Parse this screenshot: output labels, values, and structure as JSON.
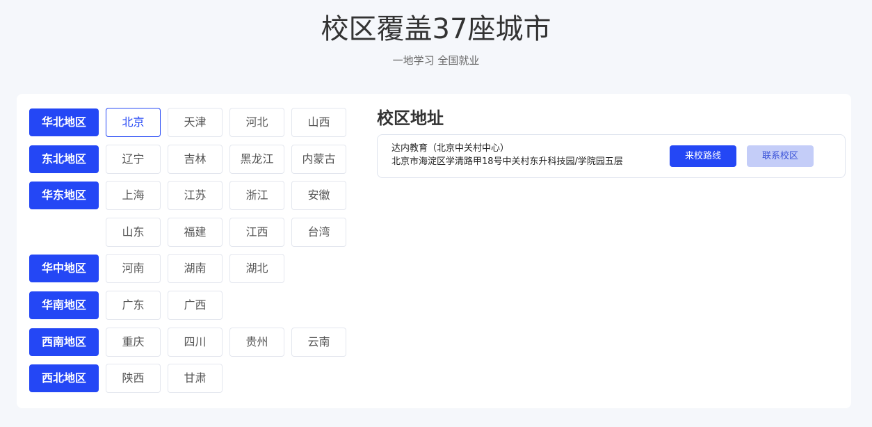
{
  "header": {
    "title": "校区覆盖37座城市",
    "subtitle": "一地学习 全国就业"
  },
  "regions": [
    {
      "label": "华北地区",
      "cities": [
        "北京",
        "天津",
        "河北",
        "山西"
      ]
    },
    {
      "label": "东北地区",
      "cities": [
        "辽宁",
        "吉林",
        "黑龙江",
        "内蒙古"
      ]
    },
    {
      "label": "华东地区",
      "cities": [
        "上海",
        "江苏",
        "浙江",
        "安徽"
      ]
    },
    {
      "label": "",
      "cities": [
        "山东",
        "福建",
        "江西",
        "台湾"
      ]
    },
    {
      "label": "华中地区",
      "cities": [
        "河南",
        "湖南",
        "湖北"
      ]
    },
    {
      "label": "华南地区",
      "cities": [
        "广东",
        "广西"
      ]
    },
    {
      "label": "西南地区",
      "cities": [
        "重庆",
        "四川",
        "贵州",
        "云南"
      ]
    },
    {
      "label": "西北地区",
      "cities": [
        "陕西",
        "甘肃"
      ]
    }
  ],
  "selected_city": "北京",
  "address": {
    "section_title": "校区地址",
    "name": "达内教育（北京中关村中心）",
    "line": "北京市海淀区学清路甲18号中关村东升科技园/学院园五层",
    "route_label": "来校路线",
    "contact_label": "联系校区"
  },
  "colors": {
    "accent": "#2447f5",
    "accent_light": "#c4cdf8",
    "page_bg": "#f5f7fb"
  }
}
